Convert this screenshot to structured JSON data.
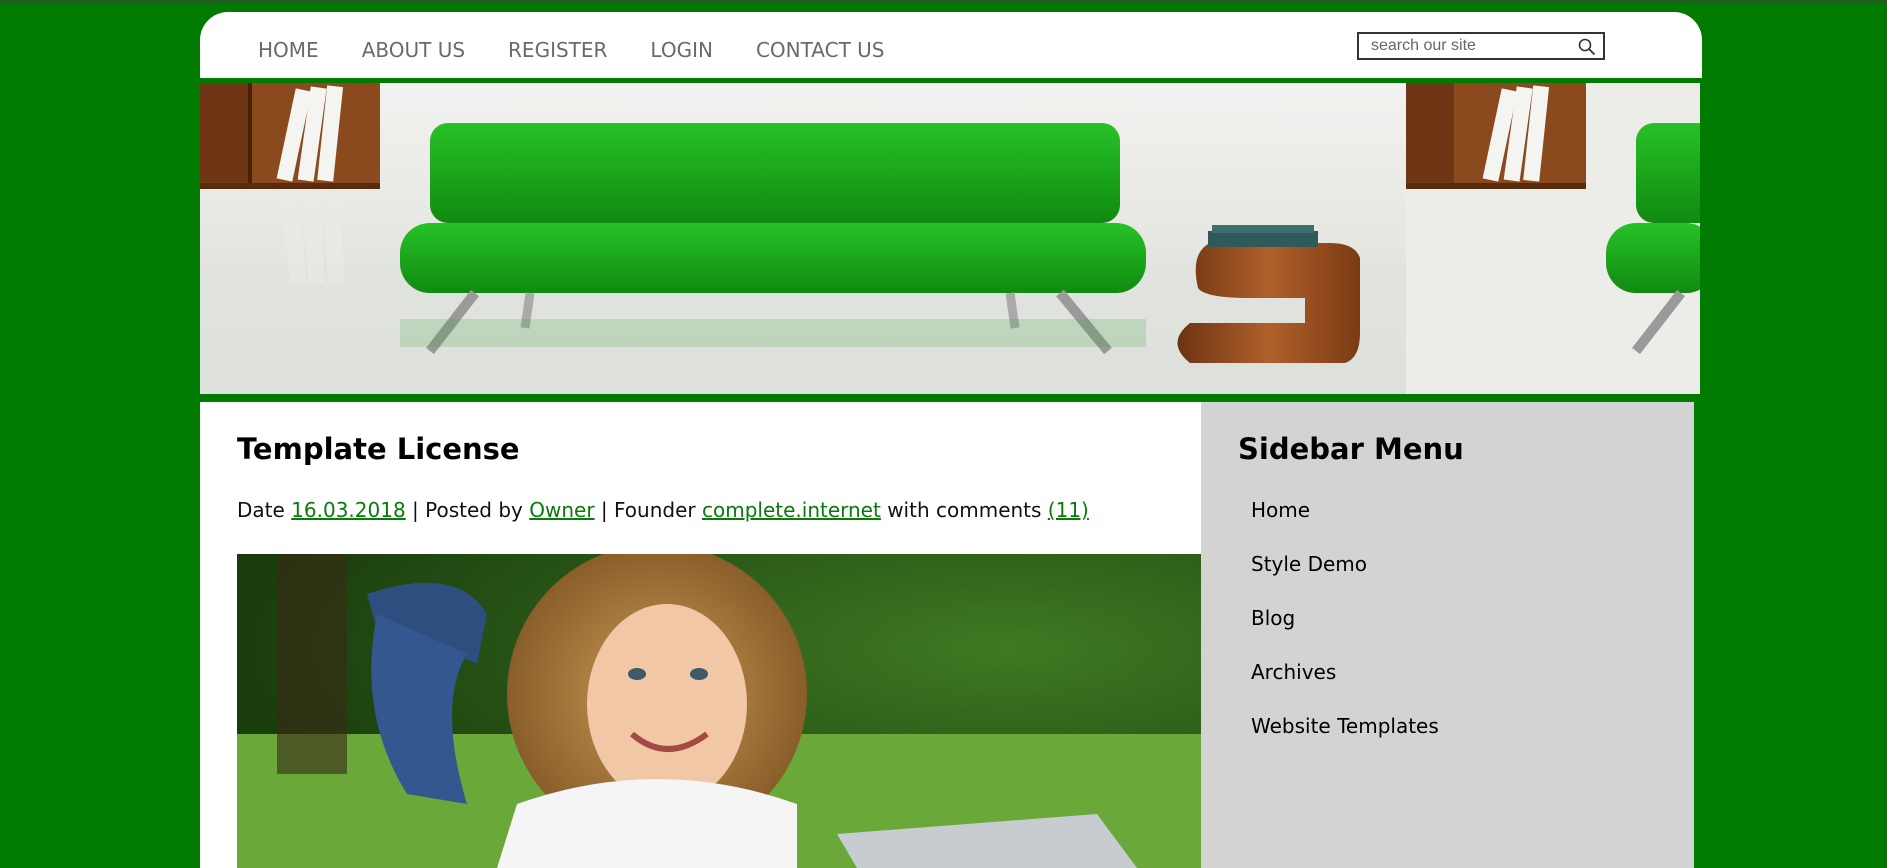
{
  "nav": {
    "items": [
      {
        "label": "HOME"
      },
      {
        "label": "ABOUT US"
      },
      {
        "label": "REGISTER"
      },
      {
        "label": "LOGIN"
      },
      {
        "label": "CONTACT US"
      }
    ]
  },
  "search": {
    "placeholder": "search our site",
    "value": "",
    "icon": "search-icon"
  },
  "banner": {
    "description_icon": "banner-image",
    "colors": {
      "sofa": "#1aa31a",
      "floor": "#ececea",
      "shelf": "#8a4a1e"
    }
  },
  "post": {
    "title": "Template License",
    "date_label": "Date",
    "date": "16.03.2018",
    "posted_by_label": "| Posted by",
    "author": "Owner",
    "founder_label": "| Founder",
    "founder": "complete.internet",
    "comments_label": "with comments",
    "comments": "(11)"
  },
  "sidebar": {
    "title": "Sidebar Menu",
    "items": [
      {
        "label": "Home"
      },
      {
        "label": "Style Demo"
      },
      {
        "label": "Blog"
      },
      {
        "label": "Archives"
      },
      {
        "label": "Website Templates"
      }
    ]
  },
  "colors": {
    "page_bg": "#007a00",
    "link": "#0a7a0a",
    "sidebar_bg": "#d3d3d3",
    "nav_text": "#6a6a6a"
  }
}
